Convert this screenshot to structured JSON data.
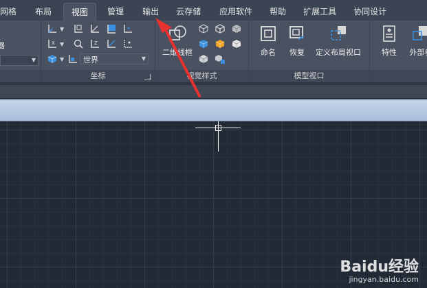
{
  "menubar": {
    "tabs": [
      {
        "label": "网格"
      },
      {
        "label": "布局"
      },
      {
        "label": "视图"
      },
      {
        "label": "管理"
      },
      {
        "label": "输出"
      },
      {
        "label": "云存储"
      },
      {
        "label": "应用软件"
      },
      {
        "label": "帮助"
      },
      {
        "label": "扩展工具"
      },
      {
        "label": "协同设计"
      }
    ],
    "active_tab": "视图"
  },
  "ribbon": {
    "left_partial": {
      "label": "器"
    },
    "coord_panel": {
      "title": "坐标",
      "ucs_dropdown_value": "世界"
    },
    "visual_styles_panel": {
      "title": "视觉样式",
      "button_label": "二维线框"
    },
    "model_viewports_panel": {
      "title": "模型视口",
      "buttons": [
        {
          "label": "命名"
        },
        {
          "label": "恢复"
        },
        {
          "label": "定义布局视口"
        }
      ]
    },
    "palettes_panel": {
      "buttons": [
        {
          "label": "特性"
        },
        {
          "label": "外部参"
        }
      ]
    }
  },
  "watermark": {
    "logo": "Baidu经验",
    "url": "jingyan.baidu.com"
  },
  "colors": {
    "menubar_bg": "#3b4453",
    "ribbon_bg": "#4a5262",
    "canvas_bg": "#222a35",
    "annotation_arrow": "#e8322f",
    "accent_blue": "#3b8fe0"
  }
}
